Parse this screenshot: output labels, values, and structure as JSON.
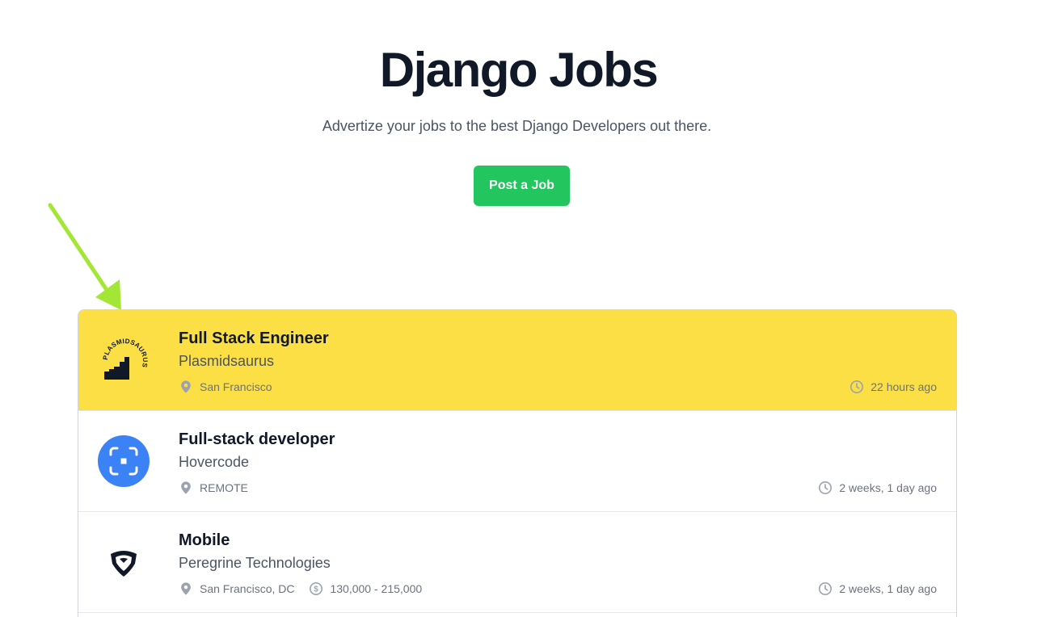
{
  "hero": {
    "title": "Django Jobs",
    "subtitle": "Advertize your jobs to the best Django Developers out there.",
    "post_job_label": "Post a Job"
  },
  "colors": {
    "accent": "#22c55e",
    "featured_bg": "#fcdf45",
    "arrow": "#a3e635"
  },
  "jobs": [
    {
      "title": "Full Stack Engineer",
      "company": "Plasmidsaurus",
      "location": "San Francisco",
      "salary": "",
      "posted": "22 hours ago",
      "featured": true,
      "logo_icon": "plasmidsaurus-logo",
      "logo_text": "PLASMIDSAURUS"
    },
    {
      "title": "Full-stack developer",
      "company": "Hovercode",
      "location": "REMOTE",
      "salary": "",
      "posted": "2 weeks, 1 day ago",
      "featured": false,
      "logo_icon": "hovercode-logo"
    },
    {
      "title": "Mobile",
      "company": "Peregrine Technologies",
      "location": "San Francisco, DC",
      "salary": "130,000 - 215,000",
      "posted": "2 weeks, 1 day ago",
      "featured": false,
      "logo_icon": "peregrine-logo"
    }
  ],
  "icons": {
    "location": "map-pin-icon",
    "salary": "dollar-circle-icon",
    "time": "clock-icon"
  }
}
